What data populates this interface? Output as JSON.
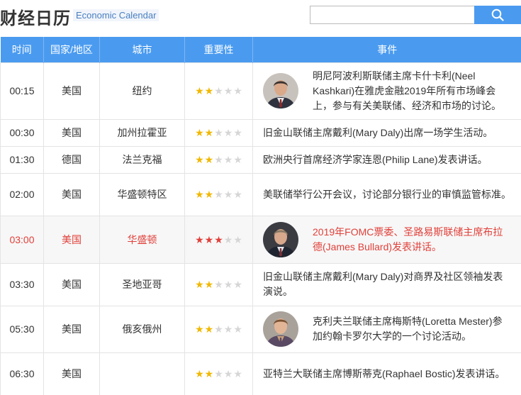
{
  "header": {
    "title": "财经日历",
    "subtitle": "Economic Calendar",
    "search_placeholder": "",
    "search_value": ""
  },
  "columns": [
    "时间",
    "国家/地区",
    "城市",
    "重要性",
    "事件"
  ],
  "rows": [
    {
      "time": "00:15",
      "country": "美国",
      "city": "纽约",
      "importance": 2,
      "event": "明尼阿波利斯联储主席卡什卡利(Neel Kashkari)在雅虎金融2019年所有市场峰会上，参与有关美联储、经济和市场的讨论。",
      "avatar": "kashkari",
      "highlight": false
    },
    {
      "time": "00:30",
      "country": "美国",
      "city": "加州拉霍亚",
      "importance": 2,
      "event": "旧金山联储主席戴利(Mary Daly)出席一场学生活动。",
      "avatar": "",
      "highlight": false
    },
    {
      "time": "01:30",
      "country": "德国",
      "city": "法兰克福",
      "importance": 2,
      "event": "欧洲央行首席经济学家连恩(Philip Lane)发表讲话。",
      "avatar": "",
      "highlight": false
    },
    {
      "time": "02:00",
      "country": "美国",
      "city": "华盛顿特区",
      "importance": 2,
      "event": "美联储举行公开会议，讨论部分银行业的审慎监管标准。",
      "avatar": "",
      "highlight": false
    },
    {
      "time": "03:00",
      "country": "美国",
      "city": "华盛顿",
      "importance": 3,
      "event": "2019年FOMC票委、圣路易斯联储主席布拉德(James Bullard)发表讲话。",
      "avatar": "bullard",
      "highlight": true
    },
    {
      "time": "03:30",
      "country": "美国",
      "city": "圣地亚哥",
      "importance": 2,
      "event": "旧金山联储主席戴利(Mary Daly)对商界及社区领袖发表演说。",
      "avatar": "",
      "highlight": false
    },
    {
      "time": "05:30",
      "country": "美国",
      "city": "俄亥俄州",
      "importance": 2,
      "event": "克利夫兰联储主席梅斯特(Loretta Mester)参加约翰卡罗尔大学的一个讨论活动。",
      "avatar": "mester",
      "highlight": false
    },
    {
      "time": "06:30",
      "country": "美国",
      "city": "",
      "importance": 2,
      "event": "亚特兰大联储主席博斯蒂克(Raphael Bostic)发表讲话。",
      "avatar": "",
      "highlight": false
    }
  ],
  "icons": {
    "search": "search-icon",
    "star": "star-icon",
    "avatar": "portrait-photo"
  },
  "colors": {
    "header_bg": "#4a9bf0",
    "highlight_text": "#e0403a",
    "star_on": "#f0b800",
    "star_off": "#d6d6d6"
  }
}
